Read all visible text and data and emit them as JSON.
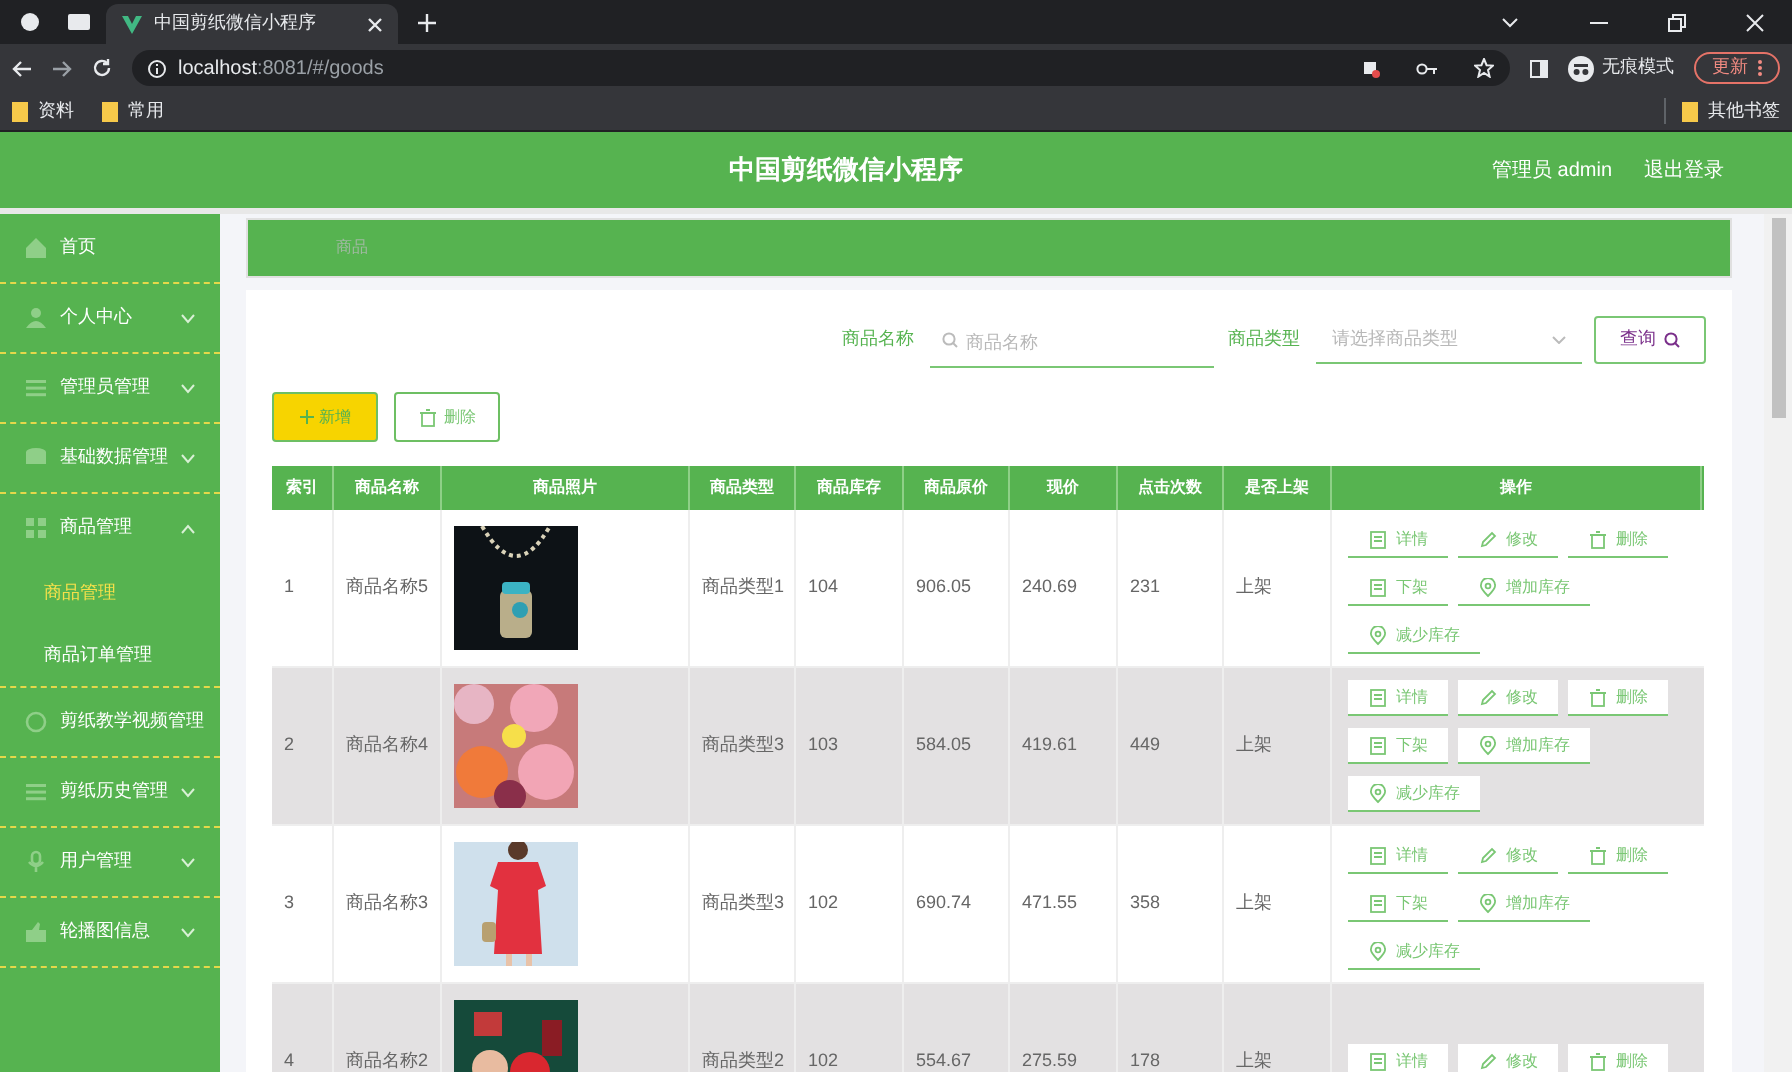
{
  "browser": {
    "tab_title": "中国剪纸微信小程序",
    "url_host": "localhost",
    "url_path": ":8081/#/goods",
    "profile_label": "无痕模式",
    "update_button": "更新",
    "bookmarks": [
      "资料",
      "常用"
    ],
    "other_bookmarks": "其他书签"
  },
  "header": {
    "title": "中国剪纸微信小程序",
    "user": "管理员 admin",
    "logout": "退出登录"
  },
  "sidebar": {
    "items": [
      {
        "label": "首页",
        "kind": "link"
      },
      {
        "label": "个人中心",
        "kind": "menu",
        "expanded": false
      },
      {
        "label": "管理员管理",
        "kind": "menu",
        "expanded": false
      },
      {
        "label": "基础数据管理",
        "kind": "menu",
        "expanded": false
      },
      {
        "label": "商品管理",
        "kind": "menu",
        "expanded": true,
        "children": [
          {
            "label": "商品管理",
            "selected": true
          },
          {
            "label": "商品订单管理",
            "selected": false
          }
        ]
      },
      {
        "label": "剪纸教学视频管理",
        "kind": "link"
      },
      {
        "label": "剪纸历史管理",
        "kind": "menu",
        "expanded": false
      },
      {
        "label": "用户管理",
        "kind": "menu",
        "expanded": false
      },
      {
        "label": "轮播图信息",
        "kind": "menu",
        "expanded": false
      }
    ]
  },
  "breadcrumb": "商品",
  "search": {
    "name_label": "商品名称",
    "name_placeholder": "商品名称",
    "type_label": "商品类型",
    "type_placeholder": "请选择商品类型",
    "query_button": "查询"
  },
  "toolbar": {
    "add": "新增",
    "delete": "删除"
  },
  "table": {
    "columns": [
      "索引",
      "商品名称",
      "商品照片",
      "商品类型",
      "商品库存",
      "商品原价",
      "现价",
      "点击次数",
      "是否上架",
      "操作"
    ],
    "rows": [
      {
        "cells": [
          "1",
          "商品名称5",
          {
            "kind": "picture"
          },
          "商品类型1",
          "104",
          "906.05",
          "240.69",
          "231",
          "上架",
          {
            "actions": [
              {
                "label": "详情",
                "kind": "detail"
              },
              {
                "label": "修改",
                "kind": "edit"
              },
              {
                "label": "删除",
                "kind": "delete"
              },
              {
                "label": "下架",
                "kind": "detail"
              },
              {
                "label": "增加库存",
                "kind": "stock"
              },
              {
                "label": "减少库存",
                "kind": "stock"
              }
            ]
          }
        ]
      },
      {
        "cells": [
          "2",
          "商品名称4",
          {
            "kind": "picture"
          },
          "商品类型3",
          "103",
          "584.05",
          "419.61",
          "449",
          "上架",
          {
            "actions": [
              {
                "label": "详情",
                "kind": "detail"
              },
              {
                "label": "修改",
                "kind": "edit"
              },
              {
                "label": "删除",
                "kind": "delete"
              },
              {
                "label": "下架",
                "kind": "detail"
              },
              {
                "label": "增加库存",
                "kind": "stock"
              },
              {
                "label": "减少库存",
                "kind": "stock"
              }
            ]
          }
        ]
      },
      {
        "cells": [
          "3",
          "商品名称3",
          {
            "kind": "picture"
          },
          "商品类型3",
          "102",
          "690.74",
          "471.55",
          "358",
          "上架",
          {
            "actions": [
              {
                "label": "详情",
                "kind": "detail"
              },
              {
                "label": "修改",
                "kind": "edit"
              },
              {
                "label": "删除",
                "kind": "delete"
              },
              {
                "label": "下架",
                "kind": "detail"
              },
              {
                "label": "增加库存",
                "kind": "stock"
              },
              {
                "label": "减少库存",
                "kind": "stock"
              }
            ]
          }
        ]
      },
      {
        "cells": [
          "4",
          "商品名称2",
          {
            "kind": "picture"
          },
          "商品类型2",
          "102",
          "554.67",
          "275.59",
          "178",
          "上架",
          {
            "actions": [
              {
                "label": "详情",
                "kind": "detail"
              },
              {
                "label": "修改",
                "kind": "edit"
              },
              {
                "label": "删除",
                "kind": "delete"
              }
            ]
          }
        ]
      }
    ]
  }
}
